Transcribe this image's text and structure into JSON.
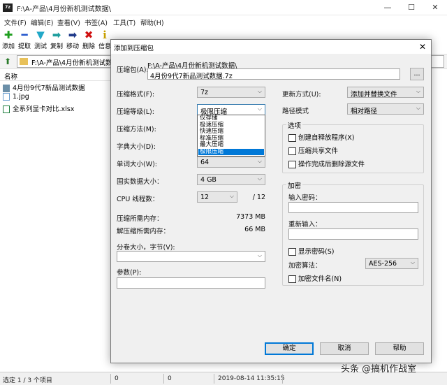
{
  "window": {
    "title": "F:\\A-产品\\4月份新机测试数据\\",
    "app_icon_text": "7z",
    "controls": {
      "minimize": "—",
      "maximize": "☐",
      "close": "✕"
    }
  },
  "menu": [
    "文件(F)",
    "编辑(E)",
    "查看(V)",
    "书签(A)",
    "工具(T)",
    "帮助(H)"
  ],
  "toolbar": [
    {
      "label": "添加",
      "icon": "add-icon",
      "glyph": "✚",
      "color": "#1e9e1e"
    },
    {
      "label": "提取",
      "icon": "extract-icon",
      "glyph": "━",
      "color": "#2255cc"
    },
    {
      "label": "测试",
      "icon": "test-icon",
      "glyph": "▼",
      "color": "#22a8c8"
    },
    {
      "label": "复制",
      "icon": "copy-icon",
      "glyph": "➡",
      "color": "#1e9e9e"
    },
    {
      "label": "移动",
      "icon": "move-icon",
      "glyph": "➡",
      "color": "#1f3a8a"
    },
    {
      "label": "删除",
      "icon": "delete-icon",
      "glyph": "✖",
      "color": "#d01010"
    },
    {
      "label": "信息",
      "icon": "info-icon",
      "glyph": "i",
      "color": "#c8a000"
    }
  ],
  "address": {
    "path": "F:\\A-产品\\4月份新机测试数据\\"
  },
  "filelist": {
    "column_name": "名称",
    "items": [
      {
        "name": "4月份9代7新品测试数据",
        "icon": "folder-icon"
      },
      {
        "name": "1.jpg",
        "icon": "image-file-icon"
      },
      {
        "name": "全系列显卡对比.xlsx",
        "icon": "excel-file-icon"
      }
    ]
  },
  "status": {
    "selection": "选定 1 / 3 个项目",
    "size1": "0",
    "size2": "0",
    "modified": "2019-08-14 11:35:15"
  },
  "dialog": {
    "title": "添加到压缩包",
    "close": "✕",
    "archive_label": "压缩包(A):",
    "archive_dir": "F:\\A-产品\\4月份新机测试数据\\",
    "archive_name": "4月份9代7新品测试数据.7z",
    "browse": "...",
    "format_label": "压缩格式(F):",
    "format_value": "7z",
    "level_label": "压缩等级(L):",
    "level_value": "极限压缩",
    "level_options": [
      "仅存储",
      "极速压缩",
      "快速压缩",
      "标准压缩",
      "最大压缩",
      "极限压缩"
    ],
    "method_label": "压缩方法(M):",
    "dict_label": "字典大小(D):",
    "word_label": "单词大小(W):",
    "word_value": "64",
    "solid_label": "固实数据大小：",
    "solid_value": "4 GB",
    "cpu_label": "CPU 线程数：",
    "cpu_value": "12",
    "cpu_total": "/ 12",
    "mem_compress_label": "压缩所需内存：",
    "mem_compress_value": "7373 MB",
    "mem_decompress_label": "解压缩所需内存：",
    "mem_decompress_value": "66 MB",
    "volume_label": "分卷大小，字节(V):",
    "params_label": "参数(P):",
    "update_label": "更新方式(U):",
    "update_value": "添加并替换文件",
    "path_label": "路径模式",
    "path_value": "相对路径",
    "options_title": "选项",
    "opt_sfx": "创建自释放程序(X)",
    "opt_shared": "压缩共享文件",
    "opt_delete": "操作完成后删除源文件",
    "enc_title": "加密",
    "enc_password_label": "输入密码：",
    "enc_reenter_label": "重新输入：",
    "enc_show": "显示密码(S)",
    "enc_method_label": "加密算法：",
    "enc_method_value": "AES-256",
    "enc_names": "加密文件名(N)",
    "ok": "确定",
    "cancel": "取消",
    "help": "帮助"
  },
  "watermark": "头条 @搞机作战室"
}
